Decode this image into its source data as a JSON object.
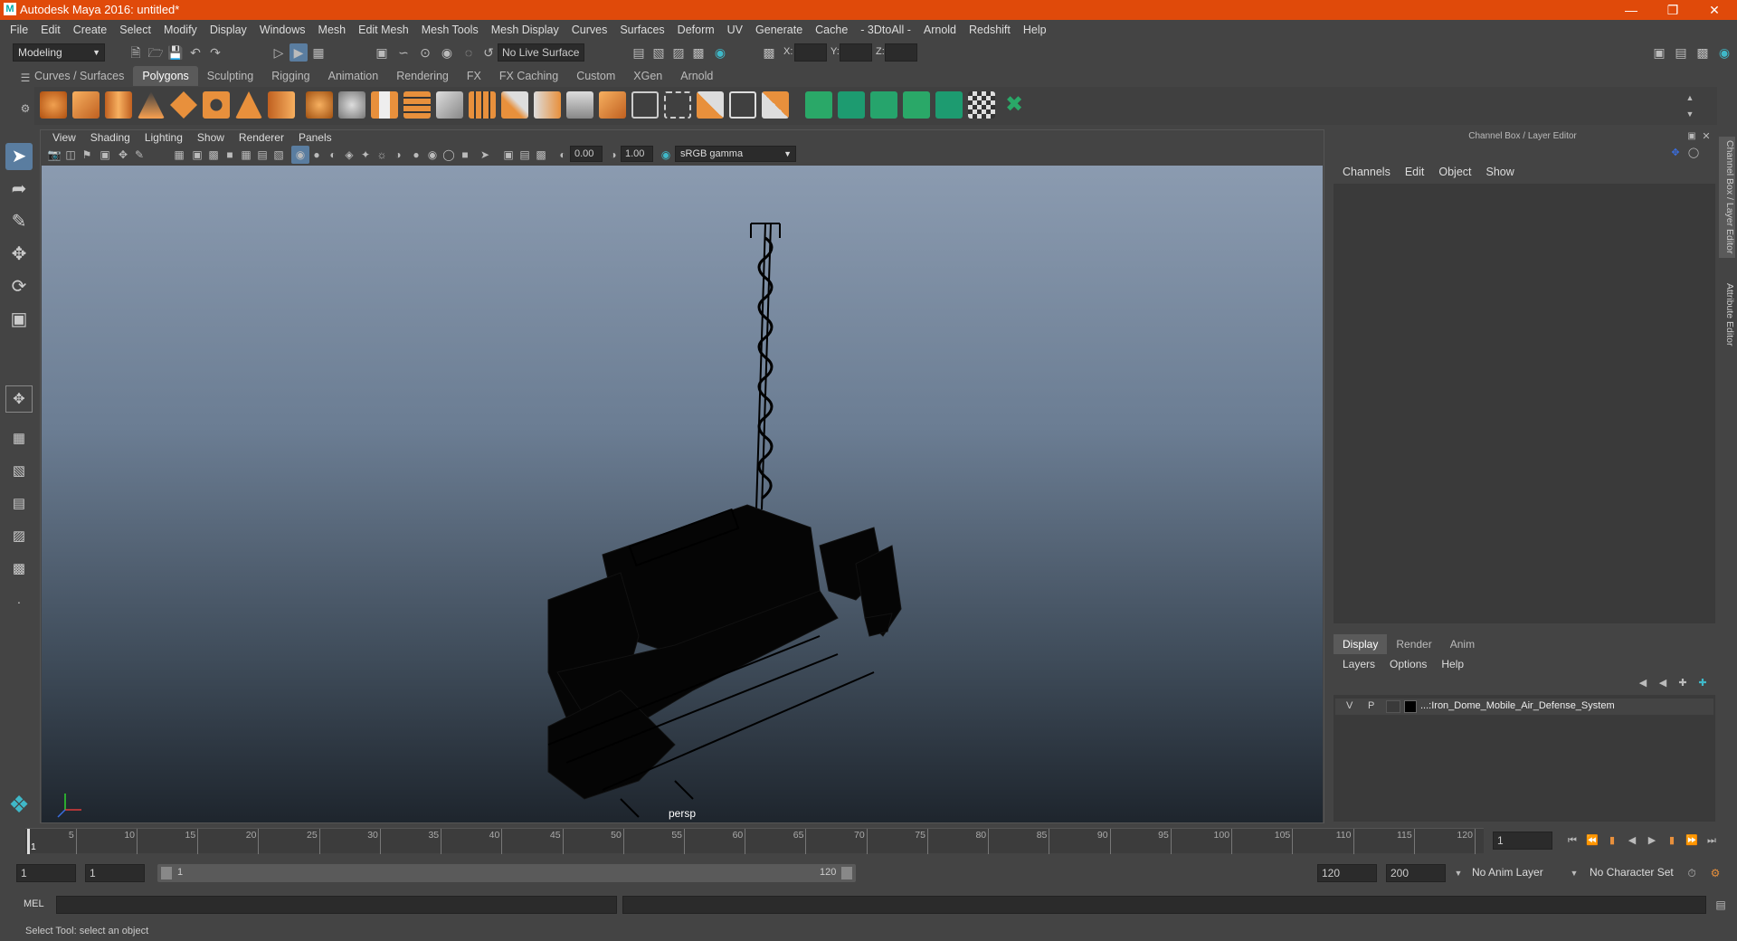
{
  "window": {
    "title": "Autodesk Maya 2016: untitled*",
    "brand_color": "#e04a0a"
  },
  "menubar": {
    "items": [
      "File",
      "Edit",
      "Create",
      "Select",
      "Modify",
      "Display",
      "Windows",
      "Mesh",
      "Edit Mesh",
      "Mesh Tools",
      "Mesh Display",
      "Curves",
      "Surfaces",
      "Deform",
      "UV",
      "Generate",
      "Cache",
      "- 3DtoAll -",
      "Arnold",
      "Redshift",
      "Help"
    ]
  },
  "status_line": {
    "mode": "Modeling",
    "live_surface": "No Live Surface",
    "x_label": "X:",
    "y_label": "Y:",
    "z_label": "Z:"
  },
  "shelf": {
    "tabs": [
      "Curves / Surfaces",
      "Polygons",
      "Sculpting",
      "Rigging",
      "Animation",
      "Rendering",
      "FX",
      "FX Caching",
      "Custom",
      "XGen",
      "Arnold"
    ],
    "active_tab": "Polygons"
  },
  "viewport": {
    "menu": [
      "View",
      "Shading",
      "Lighting",
      "Show",
      "Renderer",
      "Panels"
    ],
    "exposure": "0.00",
    "gamma": "1.00",
    "color_space": "sRGB gamma",
    "camera_label": "persp"
  },
  "channel_box": {
    "header": "Channel Box / Layer Editor",
    "menu": [
      "Channels",
      "Edit",
      "Object",
      "Show"
    ]
  },
  "layer_editor": {
    "tabs": [
      "Display",
      "Render",
      "Anim"
    ],
    "active_tab": "Display",
    "menu": [
      "Layers",
      "Options",
      "Help"
    ],
    "layers": [
      {
        "v": "V",
        "p": "P",
        "name": "...:Iron_Dome_Mobile_Air_Defense_System"
      }
    ]
  },
  "side_tabs": [
    "Channel Box / Layer Editor",
    "Attribute Editor"
  ],
  "timeline": {
    "ticks": [
      "5",
      "10",
      "15",
      "20",
      "25",
      "30",
      "35",
      "40",
      "45",
      "50",
      "55",
      "60",
      "65",
      "70",
      "75",
      "80",
      "85",
      "90",
      "95",
      "100",
      "105",
      "110",
      "115",
      "120"
    ],
    "current_frame": "1",
    "start_marker": "1"
  },
  "range_slider": {
    "start": "1",
    "playback_start": "1",
    "range_start_label": "1",
    "range_end_label": "120",
    "playback_end": "120",
    "end": "200",
    "anim_layer": "No Anim Layer",
    "character_set": "No Character Set"
  },
  "command_line": {
    "language": "MEL"
  },
  "help_line": {
    "text": "Select Tool: select an object"
  }
}
